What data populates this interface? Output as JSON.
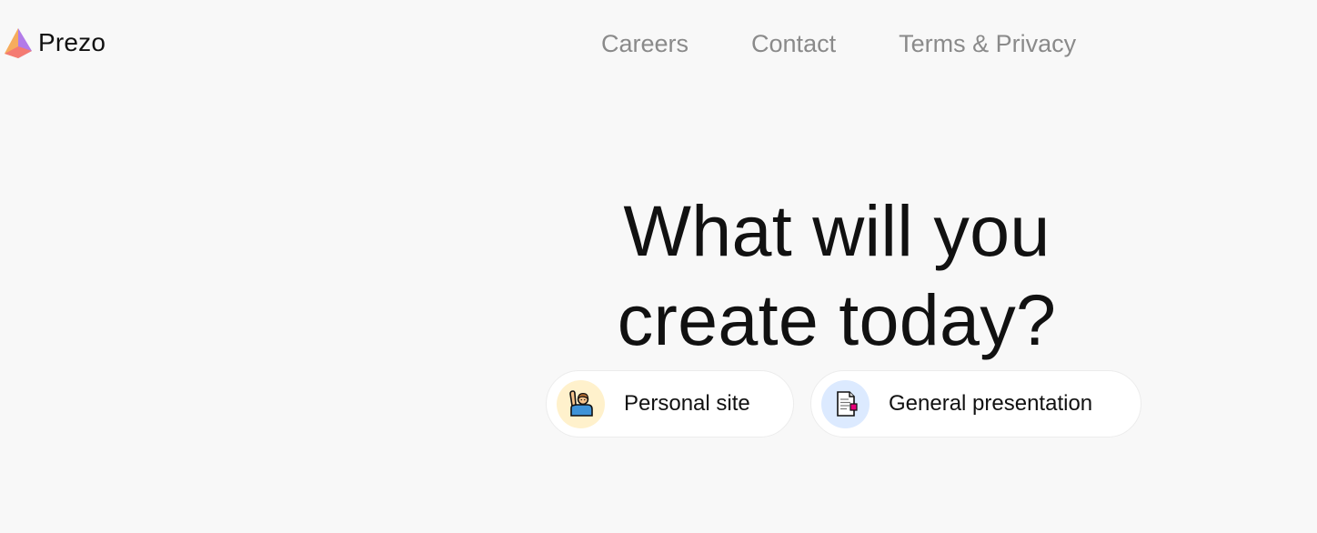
{
  "header": {
    "brand_name": "Prezo",
    "logo_icon": "prism-logo-icon",
    "nav": [
      {
        "label": "Careers"
      },
      {
        "label": "Contact"
      },
      {
        "label": "Terms & Privacy"
      }
    ]
  },
  "hero": {
    "line1": "What will you",
    "line2": "create today?"
  },
  "options": [
    {
      "label": "Personal site",
      "icon": "person-raising-hand-icon",
      "icon_bg": "#fff1cc"
    },
    {
      "label": "General presentation",
      "icon": "document-icon",
      "icon_bg": "#dceaff"
    }
  ],
  "colors": {
    "background": "#f8f8f8",
    "nav_text": "#8a8a8a",
    "heading_text": "#111111"
  }
}
